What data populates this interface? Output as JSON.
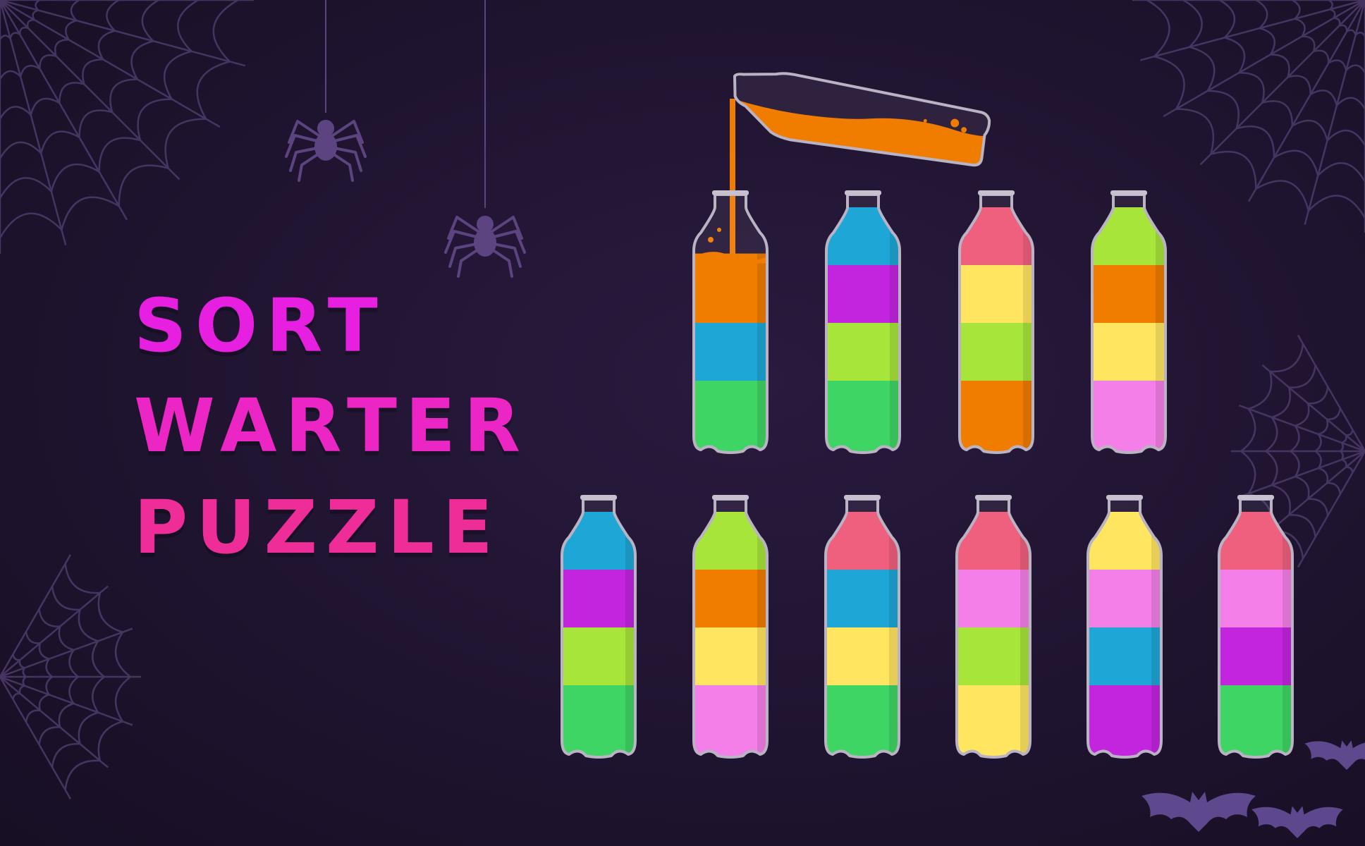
{
  "title": {
    "line1": "SORT",
    "line2": "WARTER",
    "line3": "PUZZLE"
  },
  "colors": {
    "orange": "#f07c00",
    "blue": "#1ea6d6",
    "purple": "#c325df",
    "lime": "#a8e53a",
    "green": "#3fd565",
    "red": "#ef5f7e",
    "yellow": "#ffe560",
    "pink": "#f57fe8"
  },
  "game": {
    "pouring_bottle": {
      "color": "orange",
      "level": 0.45
    },
    "bottles_top_row": [
      {
        "layers": [
          "green",
          "blue",
          "orange"
        ],
        "fill_level": 0.92,
        "receiving_pour": true
      },
      {
        "layers": [
          "green",
          "lime",
          "purple",
          "blue"
        ]
      },
      {
        "layers": [
          "orange",
          "lime",
          "yellow",
          "red"
        ]
      },
      {
        "layers": [
          "pink",
          "yellow",
          "orange",
          "lime"
        ]
      }
    ],
    "bottles_bottom_row": [
      {
        "layers": [
          "green",
          "lime",
          "purple",
          "blue"
        ]
      },
      {
        "layers": [
          "pink",
          "yellow",
          "orange",
          "lime"
        ]
      },
      {
        "layers": [
          "green",
          "yellow",
          "blue",
          "red"
        ]
      },
      {
        "layers": [
          "yellow",
          "lime",
          "pink",
          "red"
        ]
      },
      {
        "layers": [
          "purple",
          "blue",
          "pink",
          "yellow"
        ]
      },
      {
        "layers": [
          "green",
          "purple",
          "pink",
          "red"
        ]
      }
    ]
  },
  "decor": {
    "web_color": "#4a3966",
    "spider_color": "#5c4480",
    "bat_color": "#6a52a0"
  }
}
